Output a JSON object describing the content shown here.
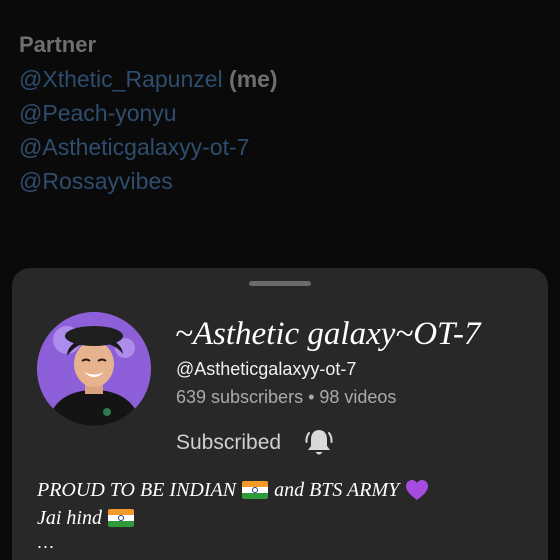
{
  "partner": {
    "heading": "Partner",
    "members": [
      {
        "handle": "@Xthetic_Rapunzel",
        "suffix": "(me)"
      },
      {
        "handle": "@Peach-yonyu",
        "suffix": ""
      },
      {
        "handle": "@Astheticgalaxyy-ot-7",
        "suffix": ""
      },
      {
        "handle": "@Rossayvibes",
        "suffix": ""
      }
    ]
  },
  "channel": {
    "name": "~Asthetic galaxy~OT-7",
    "handle": "@Astheticgalaxyy-ot-7",
    "stats": "639 subscribers • 98 videos",
    "subscribe_label": "Subscribed",
    "bell_icon": "bell-icon",
    "avatar_icon": "avatar"
  },
  "description": {
    "line1_a": "PROUD TO BE INDIAN",
    "line1_b": "and BTS ARMY",
    "line2": "Jai hind",
    "more": "..."
  },
  "colors": {
    "background": "#0a0a0a",
    "sheet": "#282828",
    "link": "#2f4d6e",
    "muted": "#aaaaaa"
  }
}
